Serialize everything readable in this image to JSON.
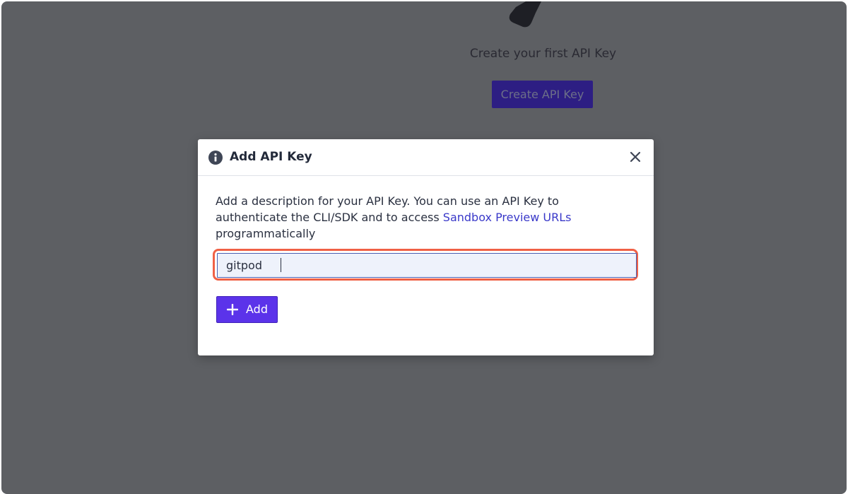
{
  "background": {
    "title": "Create your first API Key",
    "create_button_label": "Create API Key",
    "logo_icon": "key-icon"
  },
  "modal": {
    "title": "Add API Key",
    "title_icon": "info-icon",
    "close_icon": "close-icon",
    "description_prefix": "Add a description for your API Key. You can use an API Key to authenticate the CLI/SDK and to access ",
    "description_link": "Sandbox Preview URLs",
    "description_suffix": " programmatically",
    "input_value": "gitpod",
    "add_button_label": "Add",
    "add_button_icon": "plus-icon"
  },
  "colors": {
    "overlay": "#5d5f63",
    "primary": "#5b33ea",
    "link": "#3a39c9",
    "highlight": "#f06146"
  }
}
